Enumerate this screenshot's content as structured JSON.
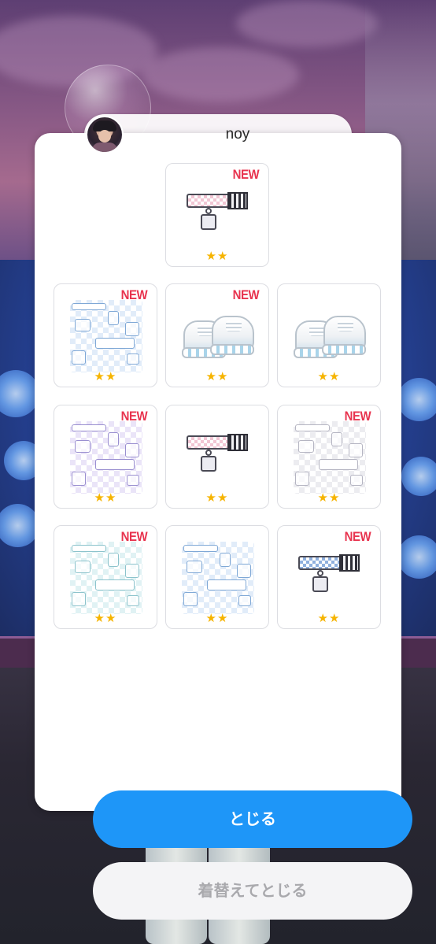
{
  "profile": {
    "username": "noy"
  },
  "items": [
    {
      "type": "choker",
      "variant": "pink",
      "is_new": true,
      "rarity": 2
    },
    {
      "type": "sticker",
      "variant": "blue",
      "is_new": true,
      "rarity": 2
    },
    {
      "type": "shoes",
      "variant": "white",
      "is_new": true,
      "rarity": 2
    },
    {
      "type": "shoes",
      "variant": "white",
      "is_new": false,
      "rarity": 2
    },
    {
      "type": "sticker",
      "variant": "purple",
      "is_new": true,
      "rarity": 2
    },
    {
      "type": "choker",
      "variant": "pink",
      "is_new": false,
      "rarity": 2
    },
    {
      "type": "sticker",
      "variant": "gray",
      "is_new": true,
      "rarity": 2
    },
    {
      "type": "sticker",
      "variant": "mint",
      "is_new": true,
      "rarity": 2
    },
    {
      "type": "sticker",
      "variant": "blue",
      "is_new": false,
      "rarity": 2
    },
    {
      "type": "choker",
      "variant": "blue",
      "is_new": true,
      "rarity": 2
    }
  ],
  "badge": {
    "new_label": "NEW",
    "stars_label": "★★"
  },
  "buttons": {
    "close_label": "とじる",
    "change_label": "着替えてとじる"
  },
  "colors": {
    "new_badge": "#e8344f",
    "star": "#f6b400",
    "primary_button": "#1e96f8",
    "secondary_button": "#f4f4f6"
  }
}
